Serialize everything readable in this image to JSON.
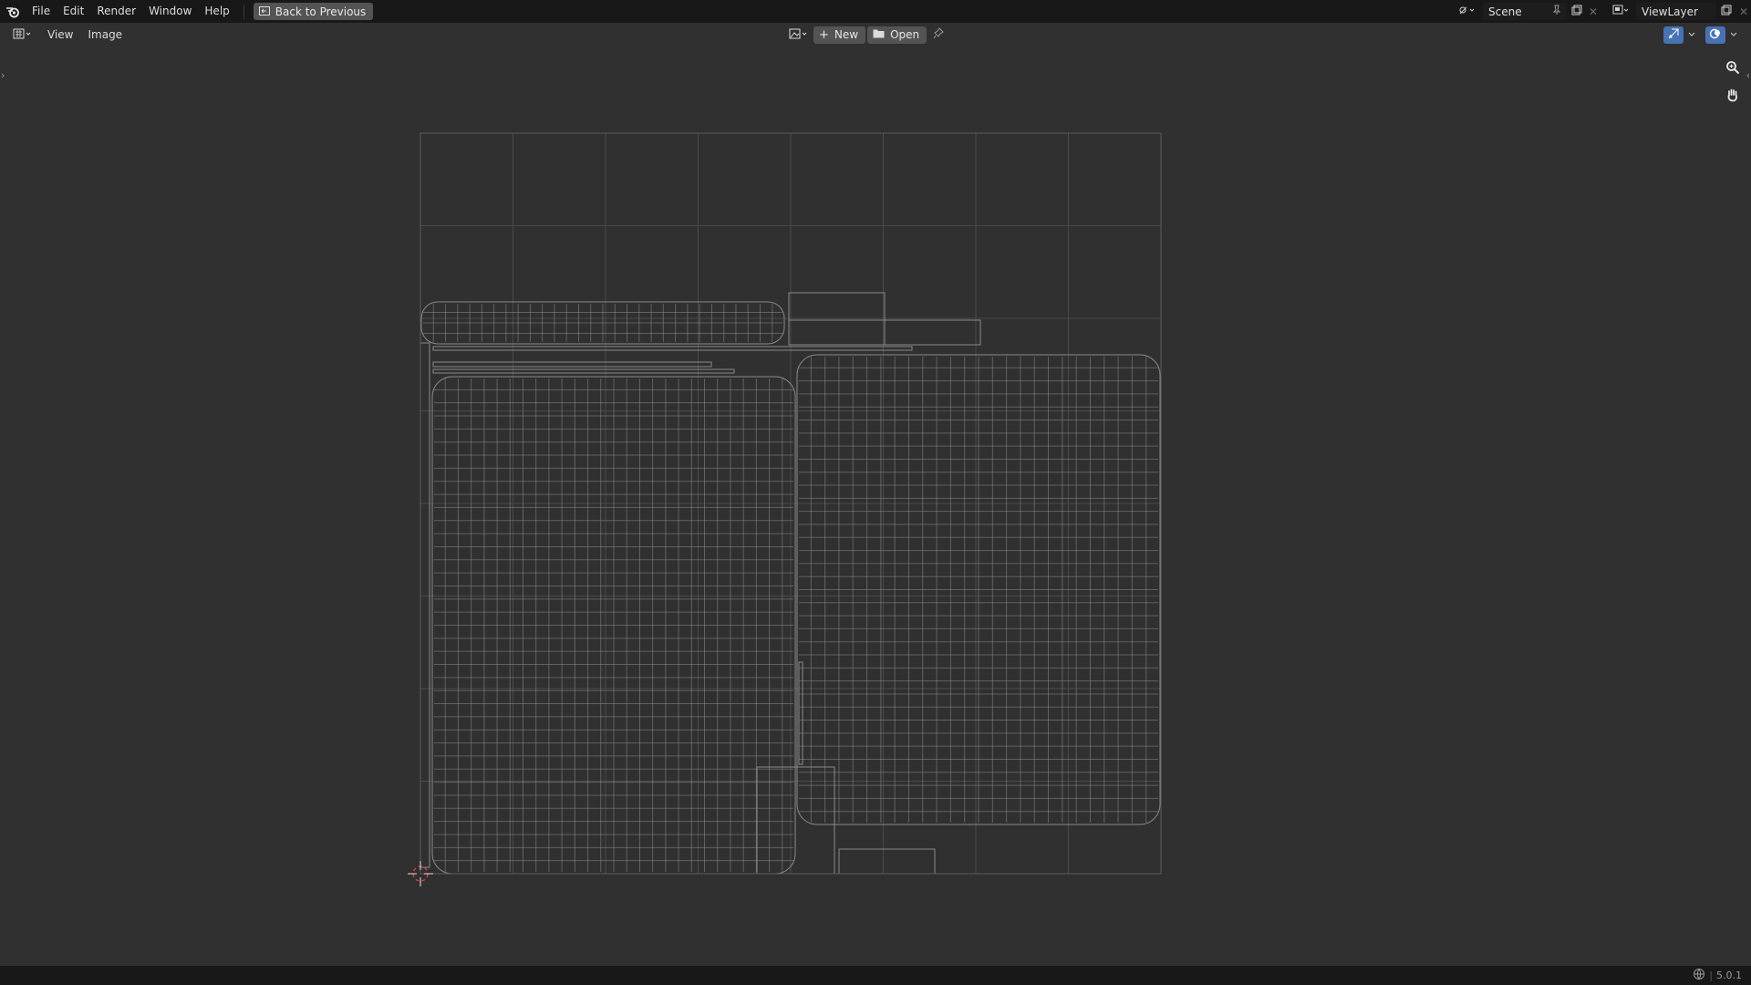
{
  "topbar": {
    "menus": [
      "File",
      "Edit",
      "Render",
      "Window",
      "Help"
    ],
    "back_label": "Back to Previous",
    "scene_name": "Scene",
    "view_layer_name": "ViewLayer"
  },
  "editor_header": {
    "menus": [
      "View",
      "Image"
    ],
    "new_label": "New",
    "open_label": "Open"
  },
  "status": {
    "version": "5.0.1"
  },
  "icons": {
    "logo": "blender-logo-icon",
    "back": "back-to-previous-icon",
    "scene": "scene-icon",
    "pin": "pin-icon",
    "new_scene": "duplicate-icon",
    "close": "close-icon",
    "view_layer": "view-layer-icon",
    "editor_type": "uv-editor-icon",
    "image_browse": "image-browse-icon",
    "new": "plus-icon",
    "open": "folder-icon",
    "gizmo": "gizmo-icon",
    "overlay": "overlay-icon",
    "zoom": "zoom-icon",
    "pan": "hand-icon",
    "cursor": "2d-cursor-icon",
    "globe": "globe-icon"
  },
  "colors": {
    "topbar_bg": "#181818",
    "viewport_bg": "#303030",
    "uv_wire": "#8a8a8a",
    "grid": "#4a4a4a",
    "cursor": "#d23c3c"
  }
}
